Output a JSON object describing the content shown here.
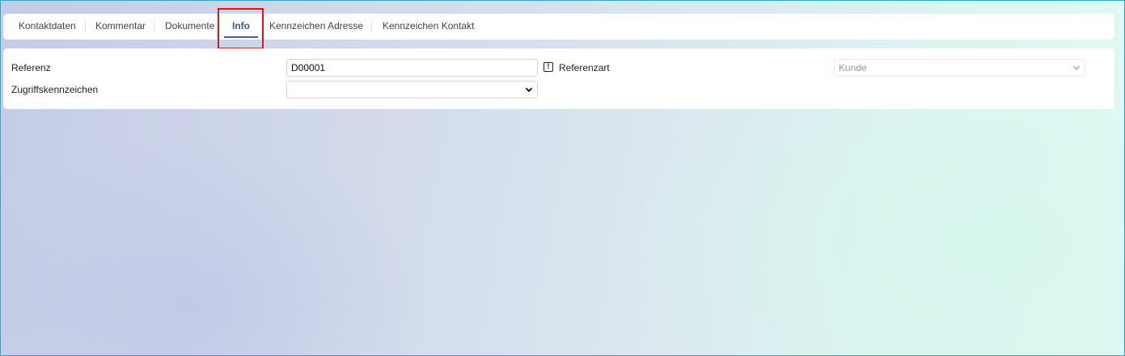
{
  "tabs": [
    {
      "label": "Kontaktdaten",
      "active": false
    },
    {
      "label": "Kommentar",
      "active": false
    },
    {
      "label": "Dokumente",
      "active": false
    },
    {
      "label": "Info",
      "active": true
    },
    {
      "label": "Kennzeichen Adresse",
      "active": false
    },
    {
      "label": "Kennzeichen Kontakt",
      "active": false
    }
  ],
  "form": {
    "referenz_label": "Referenz",
    "referenz_value": "D00001",
    "zugriffskennzeichen_label": "Zugriffskennzeichen",
    "zugriffskennzeichen_value": "",
    "referenzart_label": "Referenzart",
    "referenzart_value": "Kunde",
    "referenzart_icon": "info-icon"
  },
  "colors": {
    "accent": "#3e5e9c",
    "highlight": "#e3120b",
    "window_border": "#29a9c9"
  }
}
